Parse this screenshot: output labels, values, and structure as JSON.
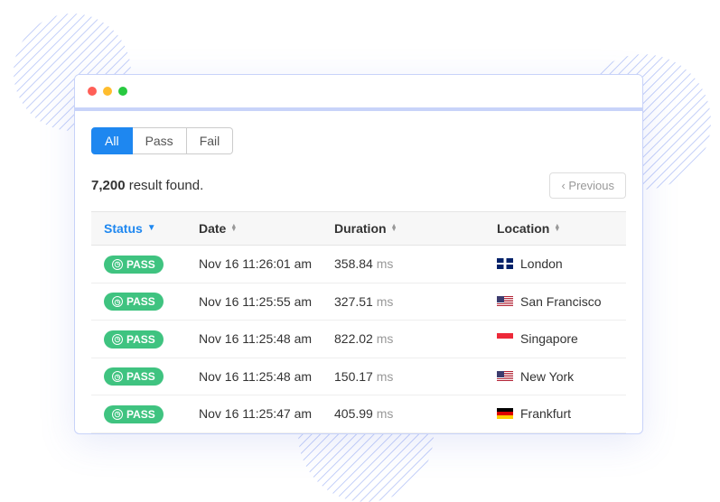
{
  "tabs": {
    "all": "All",
    "pass": "Pass",
    "fail": "Fail"
  },
  "results": {
    "count": "7,200",
    "suffix": " result found."
  },
  "pagination": {
    "previous": "‹ Previous"
  },
  "columns": {
    "status": "Status",
    "date": "Date",
    "duration": "Duration",
    "location": "Location"
  },
  "badge": {
    "pass": "PASS"
  },
  "units": {
    "ms": "ms"
  },
  "rows": [
    {
      "status": "PASS",
      "date": "Nov 16 11:26:01 am",
      "duration": "358.84",
      "location": "London",
      "flag": "uk"
    },
    {
      "status": "PASS",
      "date": "Nov 16 11:25:55 am",
      "duration": "327.51",
      "location": "San Francisco",
      "flag": "us"
    },
    {
      "status": "PASS",
      "date": "Nov 16 11:25:48 am",
      "duration": "822.02",
      "location": "Singapore",
      "flag": "sg"
    },
    {
      "status": "PASS",
      "date": "Nov 16 11:25:48 am",
      "duration": "150.17",
      "location": "New York",
      "flag": "us"
    },
    {
      "status": "PASS",
      "date": "Nov 16 11:25:47 am",
      "duration": "405.99",
      "location": "Frankfurt",
      "flag": "de"
    }
  ]
}
